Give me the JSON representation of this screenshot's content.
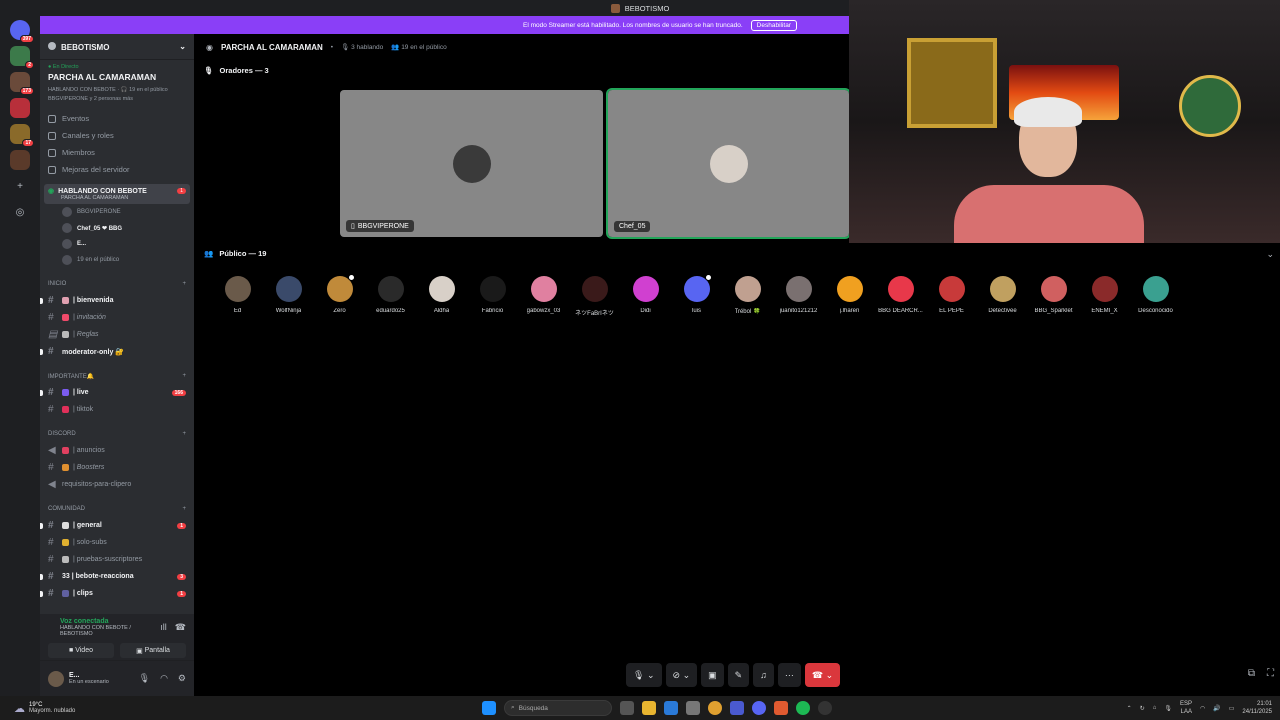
{
  "window": {
    "title": "BEBOTISMO"
  },
  "servers": [
    {
      "name": "discord-home",
      "badge": "397",
      "color": "#5865f2"
    },
    {
      "name": "server-1",
      "badge": "2",
      "color": "#3c7a4a"
    },
    {
      "name": "server-2",
      "badge": "173",
      "color": "#6a4a3a"
    },
    {
      "name": "server-3",
      "badge": "",
      "color": "#b82f3a"
    },
    {
      "name": "server-4",
      "badge": "17",
      "color": "#8a6a2a"
    },
    {
      "name": "server-5",
      "badge": "",
      "color": "#5a3a2a"
    }
  ],
  "banner": {
    "text": "El modo Streamer está habilitado. Los nombres de usuario se han truncado.",
    "button": "Deshabilitar"
  },
  "sidebar": {
    "guild_name": "BEBOTISMO",
    "event": {
      "live_tag": "En Directo",
      "title": "PARCHA AL CAMARAMAN",
      "line1": "HABLANDO CON BEBOTE · 🎧 19 en el público",
      "line2": "BBGVIPERONE y 2 personas más"
    },
    "menu": [
      {
        "label": "Eventos"
      },
      {
        "label": "Canales y roles"
      },
      {
        "label": "Miembros"
      },
      {
        "label": "Mejoras del servidor"
      }
    ],
    "voice_channel": {
      "name": "HABLANDO CON BEBOTE",
      "sub": "PARCHA AL CAMARAMAN",
      "badge": "1",
      "members": [
        {
          "name": "BBGVIPERONE",
          "bold": false
        },
        {
          "name": "Chef_05  ❤ BBG",
          "bold": true
        },
        {
          "name": "E...",
          "bold": true
        },
        {
          "name": "19 en el público",
          "bold": false
        }
      ]
    },
    "categories": [
      {
        "label": "INICIO",
        "channels": [
          {
            "name": "| bienvenida",
            "unread": true,
            "italic": false,
            "badge": "",
            "icon_color": "#e0a0b0",
            "hash": "#"
          },
          {
            "name": "| invitación",
            "unread": false,
            "italic": true,
            "badge": "",
            "icon_color": "#f04a6a",
            "hash": "#"
          },
          {
            "name": "| Reglas",
            "unread": false,
            "italic": true,
            "badge": "",
            "icon_color": "#bbbbbb",
            "hash": "▤"
          },
          {
            "name": "moderator-only 🔐",
            "unread": true,
            "italic": false,
            "badge": "",
            "icon_color": "",
            "hash": "#"
          }
        ]
      },
      {
        "label": "IMPORTANTE🔔",
        "channels": [
          {
            "name": "| live",
            "unread": true,
            "italic": false,
            "badge": "166",
            "icon_color": "#7b5cf0",
            "hash": "#"
          },
          {
            "name": "| tiktok",
            "unread": false,
            "italic": false,
            "badge": "",
            "icon_color": "#e0305a",
            "hash": "#"
          }
        ]
      },
      {
        "label": "DISCORD",
        "channels": [
          {
            "name": "| anuncios",
            "unread": false,
            "italic": false,
            "badge": "",
            "icon_color": "#e04060",
            "hash": "◀"
          },
          {
            "name": "| Boosters",
            "unread": false,
            "italic": true,
            "badge": "",
            "icon_color": "#e09030",
            "hash": "#"
          },
          {
            "name": "requisitos-para-clipero",
            "unread": false,
            "italic": false,
            "badge": "",
            "icon_color": "",
            "hash": "◀"
          }
        ]
      },
      {
        "label": "COMUNIDAD",
        "channels": [
          {
            "name": "| general",
            "unread": true,
            "italic": false,
            "badge": "1",
            "icon_color": "#dddddd",
            "hash": "#"
          },
          {
            "name": "| solo-subs",
            "unread": false,
            "italic": false,
            "badge": "",
            "icon_color": "#e0b030",
            "hash": "#"
          },
          {
            "name": "| pruebas-suscriptores",
            "unread": false,
            "italic": false,
            "badge": "",
            "icon_color": "#bbbbbb",
            "hash": "#"
          },
          {
            "name": "33 | bebote-reacciona",
            "unread": true,
            "italic": false,
            "badge": "3",
            "icon_color": "",
            "hash": "#"
          },
          {
            "name": "| clips",
            "unread": true,
            "italic": false,
            "badge": "1",
            "icon_color": "#6060a0",
            "hash": "#"
          }
        ]
      }
    ]
  },
  "voice_panel": {
    "status": "Voz conectada",
    "channel": "HABLANDO CON BEBOTE / BEBOTISMO",
    "video_label": "Video",
    "screen_label": "Pantalla"
  },
  "user_panel": {
    "name": "E...",
    "status": "En un escenario"
  },
  "stage": {
    "title": "PARCHA AL CAMARAMAN",
    "speaking": "3 hablando",
    "audience": "19 en el público",
    "speakers_label": "Oradores — 3",
    "public_label": "Público — 19",
    "speakers": [
      {
        "name": "BBGVIPERONE",
        "avatar_color": "#3a3a3a",
        "active": false,
        "device": "▯"
      },
      {
        "name": "Chef_05",
        "avatar_color": "#d8d0c8",
        "active": true,
        "device": ""
      }
    ],
    "audience_members": [
      {
        "name": "Ed",
        "color": "#6a5a4a",
        "dot": false
      },
      {
        "name": "WolfNinja",
        "color": "#3a4a6a",
        "dot": false
      },
      {
        "name": "Zero",
        "color": "#c08a3a",
        "dot": true
      },
      {
        "name": "eduardo25",
        "color": "#2a2a2a",
        "dot": false
      },
      {
        "name": "Aldha",
        "color": "#d8d0c8",
        "dot": false
      },
      {
        "name": "Fabricio",
        "color": "#1a1a1a",
        "dot": false
      },
      {
        "name": "gabowzx_03",
        "color": "#e080a0",
        "dot": false
      },
      {
        "name": "ネツFaBrIネツ",
        "color": "#3a1a1a",
        "dot": false
      },
      {
        "name": "Didi",
        "color": "#d040d0",
        "dot": false
      },
      {
        "name": "luis",
        "color": "#5865f2",
        "dot": true
      },
      {
        "name": "Trébol 🍀",
        "color": "#c0a090",
        "dot": false
      },
      {
        "name": "juanito121212",
        "color": "#7a7070",
        "dot": false
      },
      {
        "name": "j.lharen",
        "color": "#f0a020",
        "dot": false
      },
      {
        "name": "BBG DEARCR...",
        "color": "#e8384a",
        "dot": false
      },
      {
        "name": "EL PEPE",
        "color": "#c83a3a",
        "dot": false
      },
      {
        "name": "Detectivee",
        "color": "#c0a060",
        "dot": false
      },
      {
        "name": "BBG_Sparklet",
        "color": "#d06060",
        "dot": false
      },
      {
        "name": "ENEMI_X",
        "color": "#8a2a2a",
        "dot": false
      },
      {
        "name": "Desconocido",
        "color": "#3aa090",
        "dot": false
      }
    ]
  },
  "taskbar": {
    "temp": "19°C",
    "weather": "Mayorm. nublado",
    "search_placeholder": "Búsqueda",
    "lang": "ESP",
    "lang2": "LAA",
    "time": "21:01",
    "date": "24/11/2025"
  }
}
